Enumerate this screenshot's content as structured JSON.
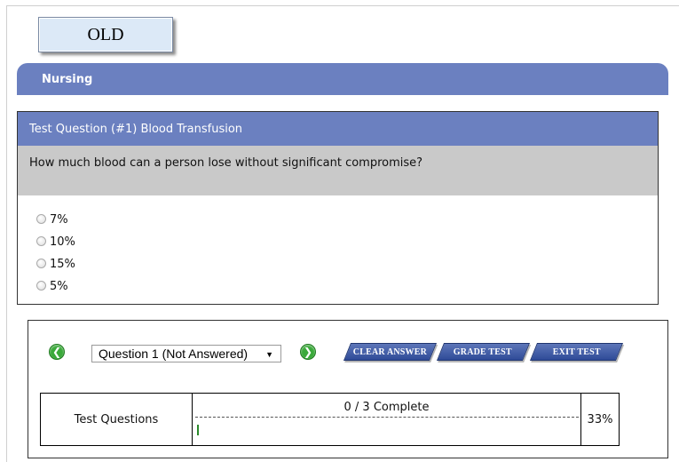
{
  "badge": {
    "label": "OLD"
  },
  "section": {
    "title": "Nursing"
  },
  "question": {
    "header": "Test Question (#1) Blood Transfusion",
    "text": "How much blood can a person lose without significant compromise?",
    "options": [
      "7%",
      "10%",
      "15%",
      "5%"
    ]
  },
  "navigation": {
    "prev_icon": "arrow-left-icon",
    "next_icon": "arrow-right-icon",
    "selected_question": "Question 1 (Not Answered)",
    "buttons": {
      "clear": "CLEAR ANSWER",
      "grade": "GRADE TEST",
      "exit": "EXIT TEST"
    }
  },
  "progress": {
    "label": "Test Questions",
    "status": "0 / 3 Complete",
    "percent": "33%",
    "fill_fraction": 0
  },
  "colors": {
    "header_blue": "#6b80c0",
    "question_gray": "#c9c9c9",
    "nav_green": "#3aa93a",
    "button_blue": "#2f4b98"
  }
}
